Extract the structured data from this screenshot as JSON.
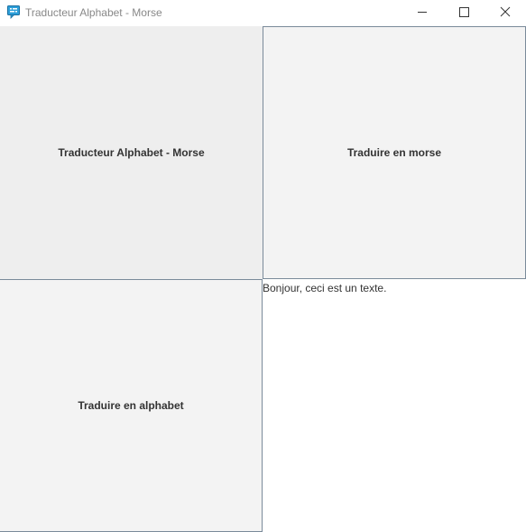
{
  "window": {
    "title": "Traducteur Alphabet - Morse",
    "app_icon": "morse-app-icon",
    "controls": {
      "minimize_icon": "minimize-icon",
      "maximize_icon": "maximize-icon",
      "close_icon": "close-icon"
    }
  },
  "main": {
    "header_label": "Traducteur Alphabet - Morse",
    "to_morse_button": "Traduire en morse",
    "to_alphabet_button": "Traduire en alphabet",
    "text_output": "Bonjour, ceci est un texte."
  },
  "colors": {
    "header_bg": "#eeeeee",
    "button_bg": "#f3f3f3",
    "button_border": "#7a8a9a",
    "icon_accent": "#2d9fd9"
  }
}
